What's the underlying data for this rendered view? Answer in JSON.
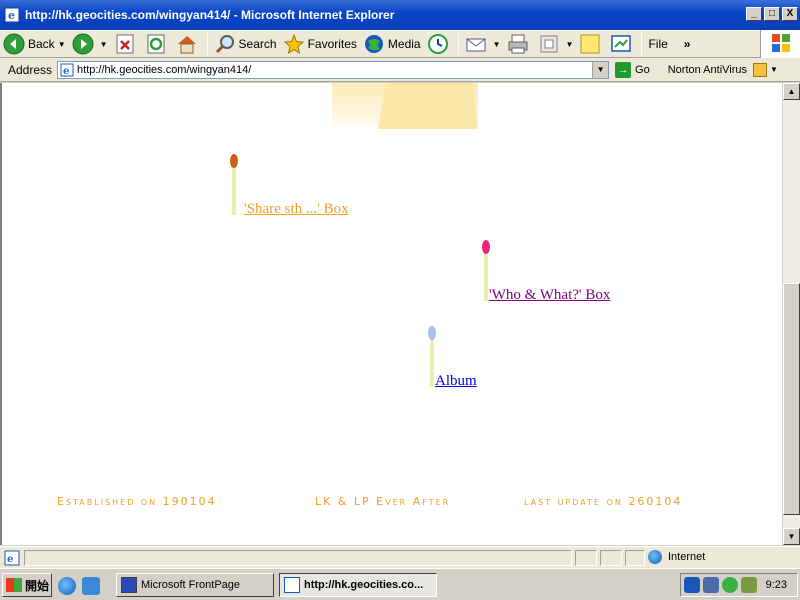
{
  "window": {
    "title": "http://hk.geocities.com/wingyan414/ - Microsoft Internet Explorer",
    "min_label": "_",
    "max_label": "□",
    "close_label": "X"
  },
  "toolbar": {
    "back_label": "Back",
    "search_label": "Search",
    "favorites_label": "Favorites",
    "media_label": "Media",
    "file_label": "File",
    "more_label": "»"
  },
  "address": {
    "label": "Address",
    "url": "http://hk.geocities.com/wingyan414/",
    "go_label": "Go",
    "norton_label": "Norton AntiVirus"
  },
  "page": {
    "links": [
      {
        "label": "'Share sth ...' Box ",
        "color": "#f0a020",
        "match_head_color": "#c8601a"
      },
      {
        "label": "'Who & What?' Box",
        "color": "#800080",
        "match_head_color": "#e82880"
      },
      {
        "label": "Album",
        "color": "#0000ee",
        "match_head_color": "#a8c0f0"
      }
    ],
    "footer": {
      "established": "Established on 190104",
      "tagline": "LK & LP Ever After",
      "last_update": "last update on 260104",
      "color": "#f0a020"
    }
  },
  "status": {
    "zone_label": "Internet"
  },
  "taskbar": {
    "start_label": "開始",
    "tasks": [
      {
        "label": "Microsoft FrontPage",
        "active": false
      },
      {
        "label": "http://hk.geocities.co...",
        "active": true
      }
    ],
    "clock": "9:23"
  }
}
